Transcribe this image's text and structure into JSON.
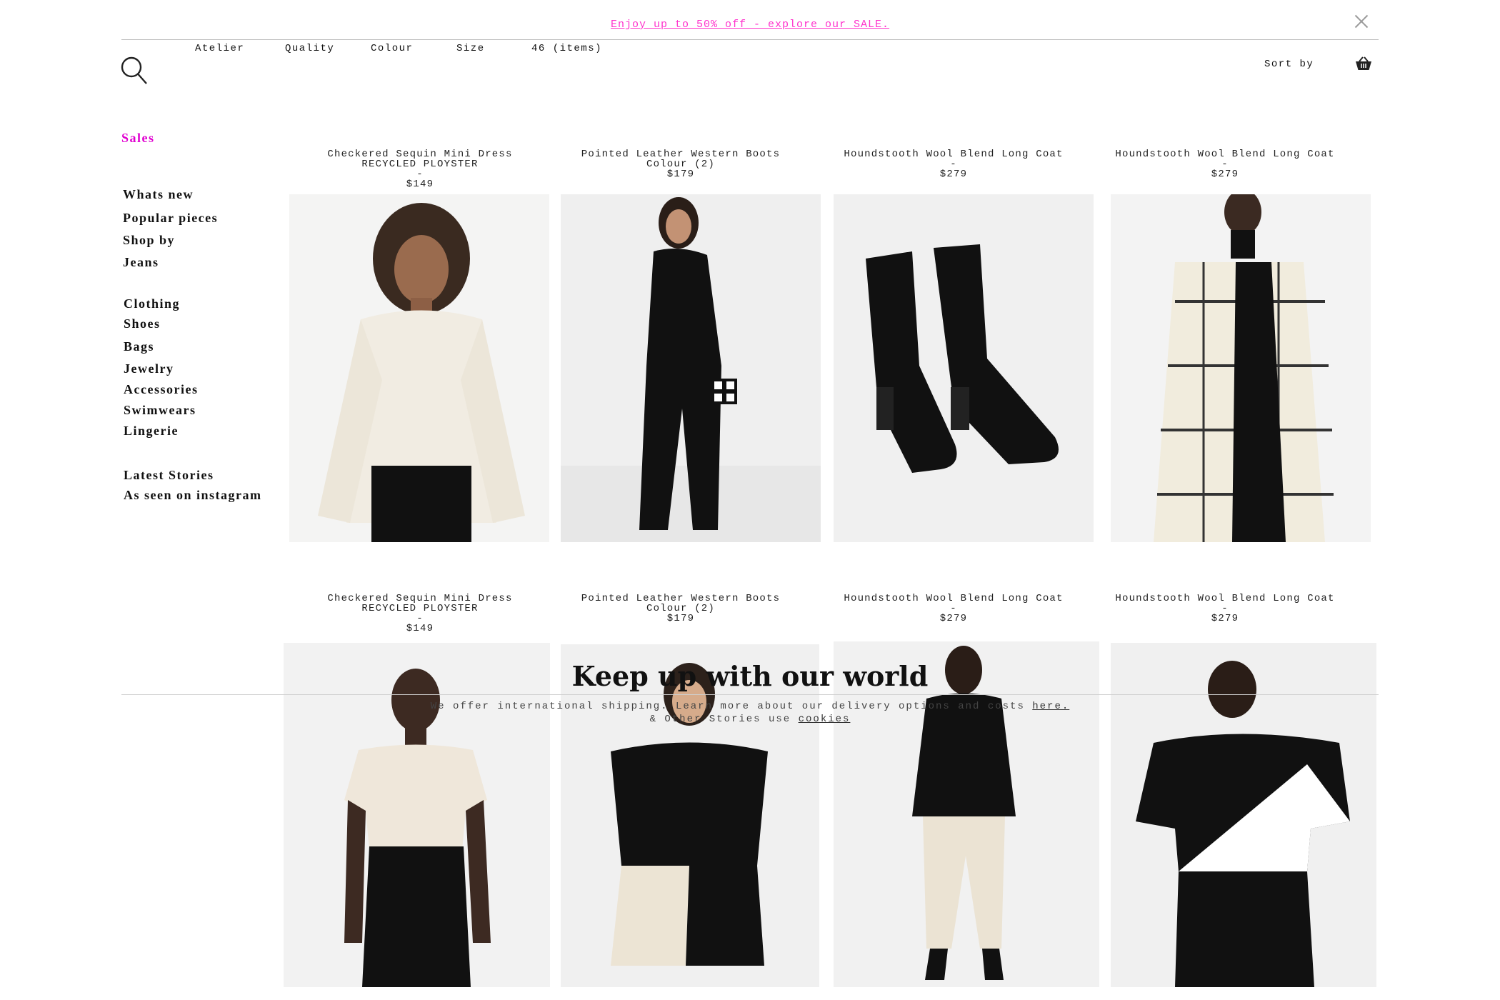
{
  "promo": {
    "text": "Enjoy up to 50% off - explore our SALE.",
    "color": "#ff33cc"
  },
  "filters": [
    {
      "label": "Atelier"
    },
    {
      "label": "Quality"
    },
    {
      "label": "Colour"
    },
    {
      "label": "Size"
    },
    {
      "label": "46 (items)"
    }
  ],
  "sort_label": "Sort by",
  "sidebar": {
    "sales": "Sales",
    "sales_color": "#e000d0",
    "group1": [
      "Whats new",
      "Popular pieces",
      "Shop by",
      "Jeans"
    ],
    "group2": [
      "Clothing",
      "Shoes",
      "Bags",
      "Jewelry",
      "Accessories",
      "Swimwears",
      "Lingerie"
    ],
    "group3": [
      "Latest Stories",
      "As seen on instagram"
    ]
  },
  "products_row1": [
    {
      "lines": [
        "Checkered Sequin Mini Dress",
        "RECYCLED PLOYSTER",
        "-",
        "$149"
      ],
      "image": "woman in cream long-sleeve blouse"
    },
    {
      "lines": [
        "Pointed Leather Western Boots",
        "Colour (2)",
        "$179"
      ],
      "image": "woman in black outfit with checkered bag"
    },
    {
      "lines": [
        "Houndstooth Wool Blend Long Coat",
        "-",
        "$279"
      ],
      "image": "black suede heeled ankle boots"
    },
    {
      "lines": [
        "Houndstooth Wool Blend Long Coat",
        "-",
        "$279"
      ],
      "image": "woman in checked overshirt coat"
    }
  ],
  "products_row2": [
    {
      "lines": [
        "Checkered Sequin Mini Dress",
        "RECYCLED PLOYSTER",
        "-",
        "$149"
      ],
      "image": "woman in cream t-shirt and black trousers"
    },
    {
      "lines": [
        "Pointed Leather Western Boots",
        "Colour (2)",
        "$179"
      ],
      "image": "woman in black tee and two-tone shorts"
    },
    {
      "lines": [
        "Houndstooth Wool Blend Long Coat",
        "-",
        "$279"
      ],
      "image": "woman in black hoodie and cream trousers"
    },
    {
      "lines": [
        "Houndstooth Wool Blend Long Coat",
        "-",
        "$279"
      ],
      "image": "woman in black and white colour-block tee"
    }
  ],
  "newsletter": {
    "title": "Keep up with our world",
    "shipping_text": "We offer international shipping. Learn more about our delivery options and costs",
    "shipping_link": "here.",
    "cookie_text": "& Other Stories use",
    "cookie_link": "cookies"
  }
}
